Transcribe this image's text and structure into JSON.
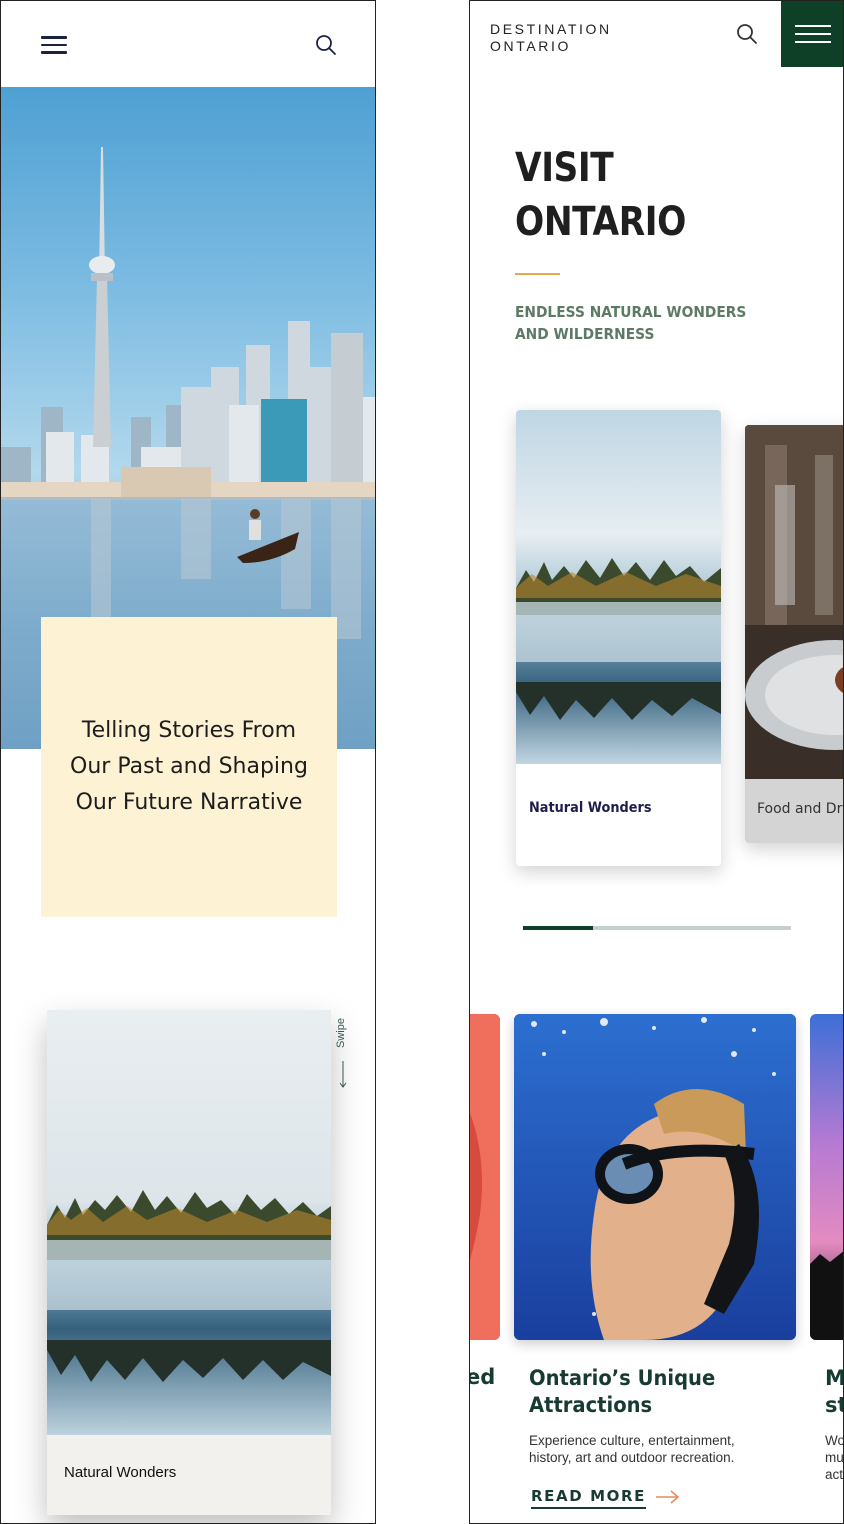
{
  "left_screen": {
    "story_text": "Telling Stories From Our Past and Shaping Our Future Narrative",
    "swipe_label": "Swipe",
    "card_caption": "Natural Wonders"
  },
  "right_screen": {
    "logo_line1": "DESTINATION",
    "logo_line2": "ONTARIO",
    "title_line1": "VISIT",
    "title_line2": "ONTARIO",
    "subtitle_line1": "ENDLESS NATURAL WONDERS",
    "subtitle_line2": "AND WILDERNESS",
    "categories": [
      {
        "label": "Natural Wonders"
      },
      {
        "label": "Food and Dri"
      }
    ],
    "carousel_progress": 0.26,
    "attraction": {
      "title": "Ontario’s Unique Attractions",
      "description": "Experience culture, entertainment, history, art and outdoor recreation.",
      "cta": "READ MORE"
    },
    "edge_left_title": "ed",
    "edge_right_title_1": "M",
    "edge_right_title_2": "st",
    "edge_right_desc_1": "Wo",
    "edge_right_desc_2": "mu",
    "edge_right_desc_3": "act"
  },
  "colors": {
    "brand_green": "#0d4027",
    "accent_gold": "#e6a84b",
    "story_box_bg": "#fdf2d3",
    "cta_arrow": "#e88a5c"
  },
  "icons": [
    "menu-icon",
    "search-icon",
    "arrow-left-icon",
    "arrow-right-icon"
  ]
}
